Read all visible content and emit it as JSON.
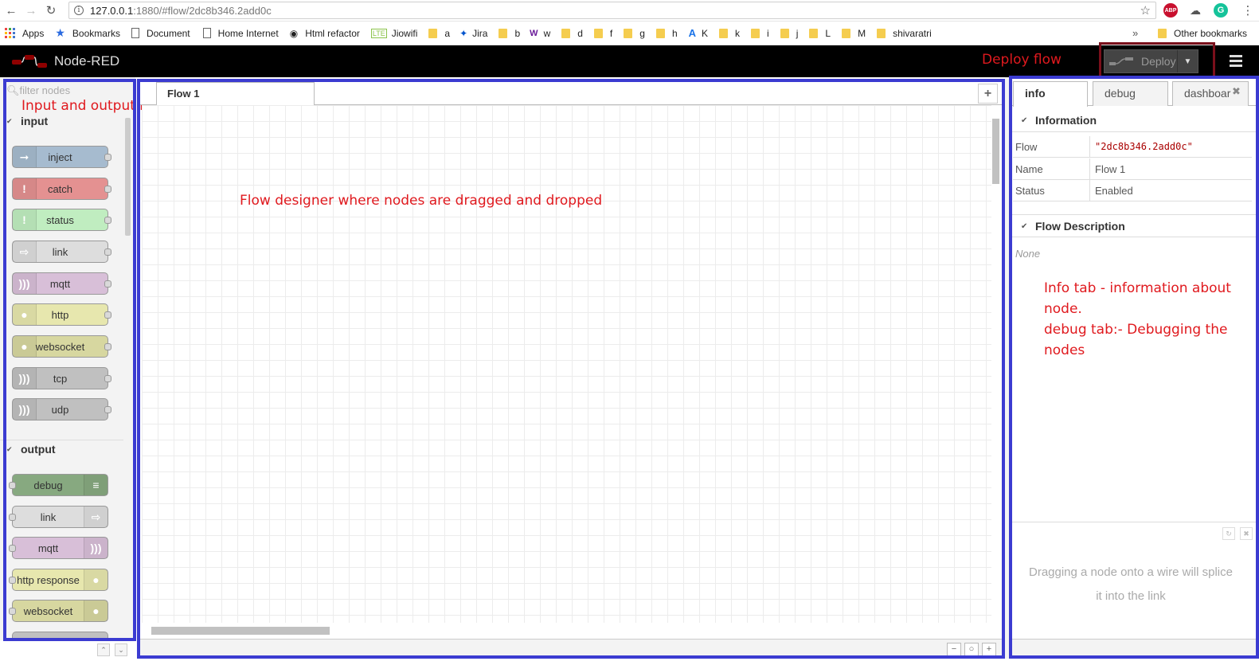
{
  "browser": {
    "url_host": "127.0.0.1",
    "url_path": ":1880/#flow/2dc8b346.2add0c",
    "bookmarks": [
      {
        "label": "Apps",
        "icon": "apps-icon"
      },
      {
        "label": "Bookmarks",
        "icon": "star-icon"
      },
      {
        "label": "Document",
        "icon": "document-icon"
      },
      {
        "label": "Home Internet",
        "icon": "document-icon"
      },
      {
        "label": "Html refactor",
        "icon": "site-icon"
      },
      {
        "label": "Jiowifi",
        "icon": "lte-icon"
      },
      {
        "label": "a",
        "icon": "folder-icon"
      },
      {
        "label": "Jira",
        "icon": "jira-icon"
      },
      {
        "label": "b",
        "icon": "folder-icon"
      },
      {
        "label": "w",
        "icon": "site-icon"
      },
      {
        "label": "d",
        "icon": "folder-icon"
      },
      {
        "label": "f",
        "icon": "folder-icon"
      },
      {
        "label": "g",
        "icon": "folder-icon"
      },
      {
        "label": "h",
        "icon": "folder-icon"
      },
      {
        "label": "K",
        "icon": "site-icon"
      },
      {
        "label": "k",
        "icon": "folder-icon"
      },
      {
        "label": "i",
        "icon": "folder-icon"
      },
      {
        "label": "j",
        "icon": "folder-icon"
      },
      {
        "label": "L",
        "icon": "folder-icon"
      },
      {
        "label": "M",
        "icon": "folder-icon"
      },
      {
        "label": "shivaratri",
        "icon": "folder-icon"
      }
    ],
    "overflow": "»",
    "other_bookmarks": "Other bookmarks"
  },
  "app": {
    "title": "Node-RED",
    "deploy_label": "Deploy"
  },
  "palette": {
    "filter_placeholder": "filter nodes",
    "categories": [
      {
        "label": "input",
        "nodes": [
          "inject",
          "catch",
          "status",
          "link",
          "mqtt",
          "http",
          "websocket",
          "tcp",
          "udp"
        ]
      },
      {
        "label": "output",
        "nodes": [
          "debug",
          "link",
          "mqtt",
          "http response",
          "websocket"
        ]
      }
    ]
  },
  "workspace": {
    "tab_label": "Flow 1",
    "add_tab": "+"
  },
  "sidebar": {
    "tabs": [
      "info",
      "debug",
      "dashboar"
    ],
    "information_title": "Information",
    "props": [
      {
        "key": "Flow",
        "value": "\"2dc8b346.2add0c\""
      },
      {
        "key": "Name",
        "value": "Flow 1"
      },
      {
        "key": "Status",
        "value": "Enabled"
      }
    ],
    "description_title": "Flow Description",
    "description": "None",
    "tip_line1": "Dragging a node onto a wire will splice",
    "tip_line2": "it into the link"
  },
  "annotations": {
    "deploy": "Deploy flow",
    "palette": "Input and output nodes",
    "workspace": "Flow designer where nodes are dragged and dropped",
    "info_line1": "Info tab - information about",
    "info_line2": "node.",
    "info_line3": "debug tab:- Debugging the",
    "info_line4": "nodes"
  },
  "colors": {
    "annotation_text": "#e0191e",
    "annotation_frame": "#3b3bd1",
    "deploy_frame": "#7a0f1b",
    "inject": "#a6bbcf",
    "catch": "#e49191",
    "status": "#c0edc0",
    "link": "#dddddd",
    "mqtt": "#d8bfd8",
    "http": "#e7e7ae",
    "net": "#c0c0c0",
    "debug": "#87a980"
  }
}
